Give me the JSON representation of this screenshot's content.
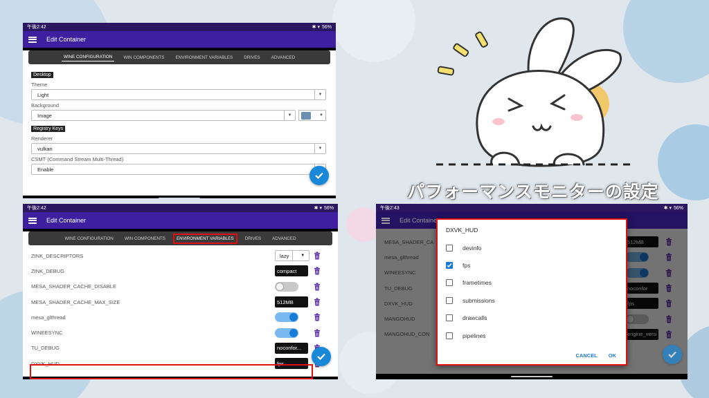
{
  "panel1": {
    "status_time": "午後2:42",
    "status_battery": "56%",
    "app_title": "Edit Container",
    "tabs": [
      "WINE CONFIGURATION",
      "WIN COMPONENTS",
      "ENVIRONMENT VARIABLES",
      "DRIVES",
      "ADVANCED"
    ],
    "active_tab": "WINE CONFIGURATION",
    "desktop_section": "Desktop",
    "theme_label": "Theme",
    "theme_value": "Light",
    "background_label": "Background",
    "background_value": "Image",
    "registry_section": "Registry Keys",
    "renderer_label": "Renderer",
    "renderer_value": "vulkan",
    "csmt_label": "CSMT (Command Stream Multi-Thread)",
    "csmt_value": "Enable"
  },
  "panel2": {
    "status_time": "午後2:42",
    "status_battery": "56%",
    "app_title": "Edit Container",
    "tabs": [
      "WINE CONFIGURATION",
      "WIN COMPONENTS",
      "ENVIRONMENT VARIABLES",
      "DRIVES",
      "ADVANCED"
    ],
    "highlighted_tab": "ENVIRONMENT VARIABLES",
    "rows": [
      {
        "name": "ZINK_DESCRIPTORS",
        "kind": "select",
        "value": "lazy"
      },
      {
        "name": "ZINK_DEBUG",
        "kind": "text",
        "value": "compact"
      },
      {
        "name": "MESA_SHADER_CACHE_DISABLE",
        "kind": "toggle",
        "on": false
      },
      {
        "name": "MESA_SHADER_CACHE_MAX_SIZE",
        "kind": "text",
        "value": "512MB"
      },
      {
        "name": "mesa_glthread",
        "kind": "toggle",
        "on": true
      },
      {
        "name": "WINEESYNC",
        "kind": "toggle",
        "on": true
      },
      {
        "name": "TU_DEBUG",
        "kind": "text",
        "value": "noconfor..."
      },
      {
        "name": "DXVK_HUD",
        "kind": "text",
        "value": "fps"
      }
    ]
  },
  "title_overlay": "パフォーマンスモニターの設定",
  "panel3": {
    "status_time": "午後2:43",
    "status_battery": "56%",
    "app_title": "Edit Container",
    "bg_rows": [
      {
        "name": "MESA_SHADER_CA",
        "kind": "text",
        "value": "512MB"
      },
      {
        "name": "mesa_glthread",
        "kind": "toggle",
        "on": true
      },
      {
        "name": "WINEESYNC",
        "kind": "toggle",
        "on": true
      },
      {
        "name": "TU_DEBUG",
        "kind": "text",
        "value": "noconfor"
      },
      {
        "name": "DXVK_HUD",
        "kind": "text",
        "value": "fps"
      },
      {
        "name": "MANGOHUD",
        "kind": "toggle",
        "on": false
      },
      {
        "name": "MANGOHUD_CON",
        "kind": "text",
        "value": "engine_versi"
      }
    ],
    "dialog": {
      "title": "DXVK_HUD",
      "options": [
        {
          "label": "devinfo",
          "checked": false
        },
        {
          "label": "fps",
          "checked": true
        },
        {
          "label": "frametimes",
          "checked": false
        },
        {
          "label": "submissions",
          "checked": false
        },
        {
          "label": "drawcalls",
          "checked": false
        },
        {
          "label": "pipelines",
          "checked": false
        }
      ],
      "cancel": "CANCEL",
      "ok": "OK"
    }
  },
  "colors": {
    "appbar": "#3d1fa0",
    "statusbar": "#2a1760",
    "accent": "#1a88d8",
    "highlight": "#e01010",
    "trash": "#5a2da8"
  }
}
